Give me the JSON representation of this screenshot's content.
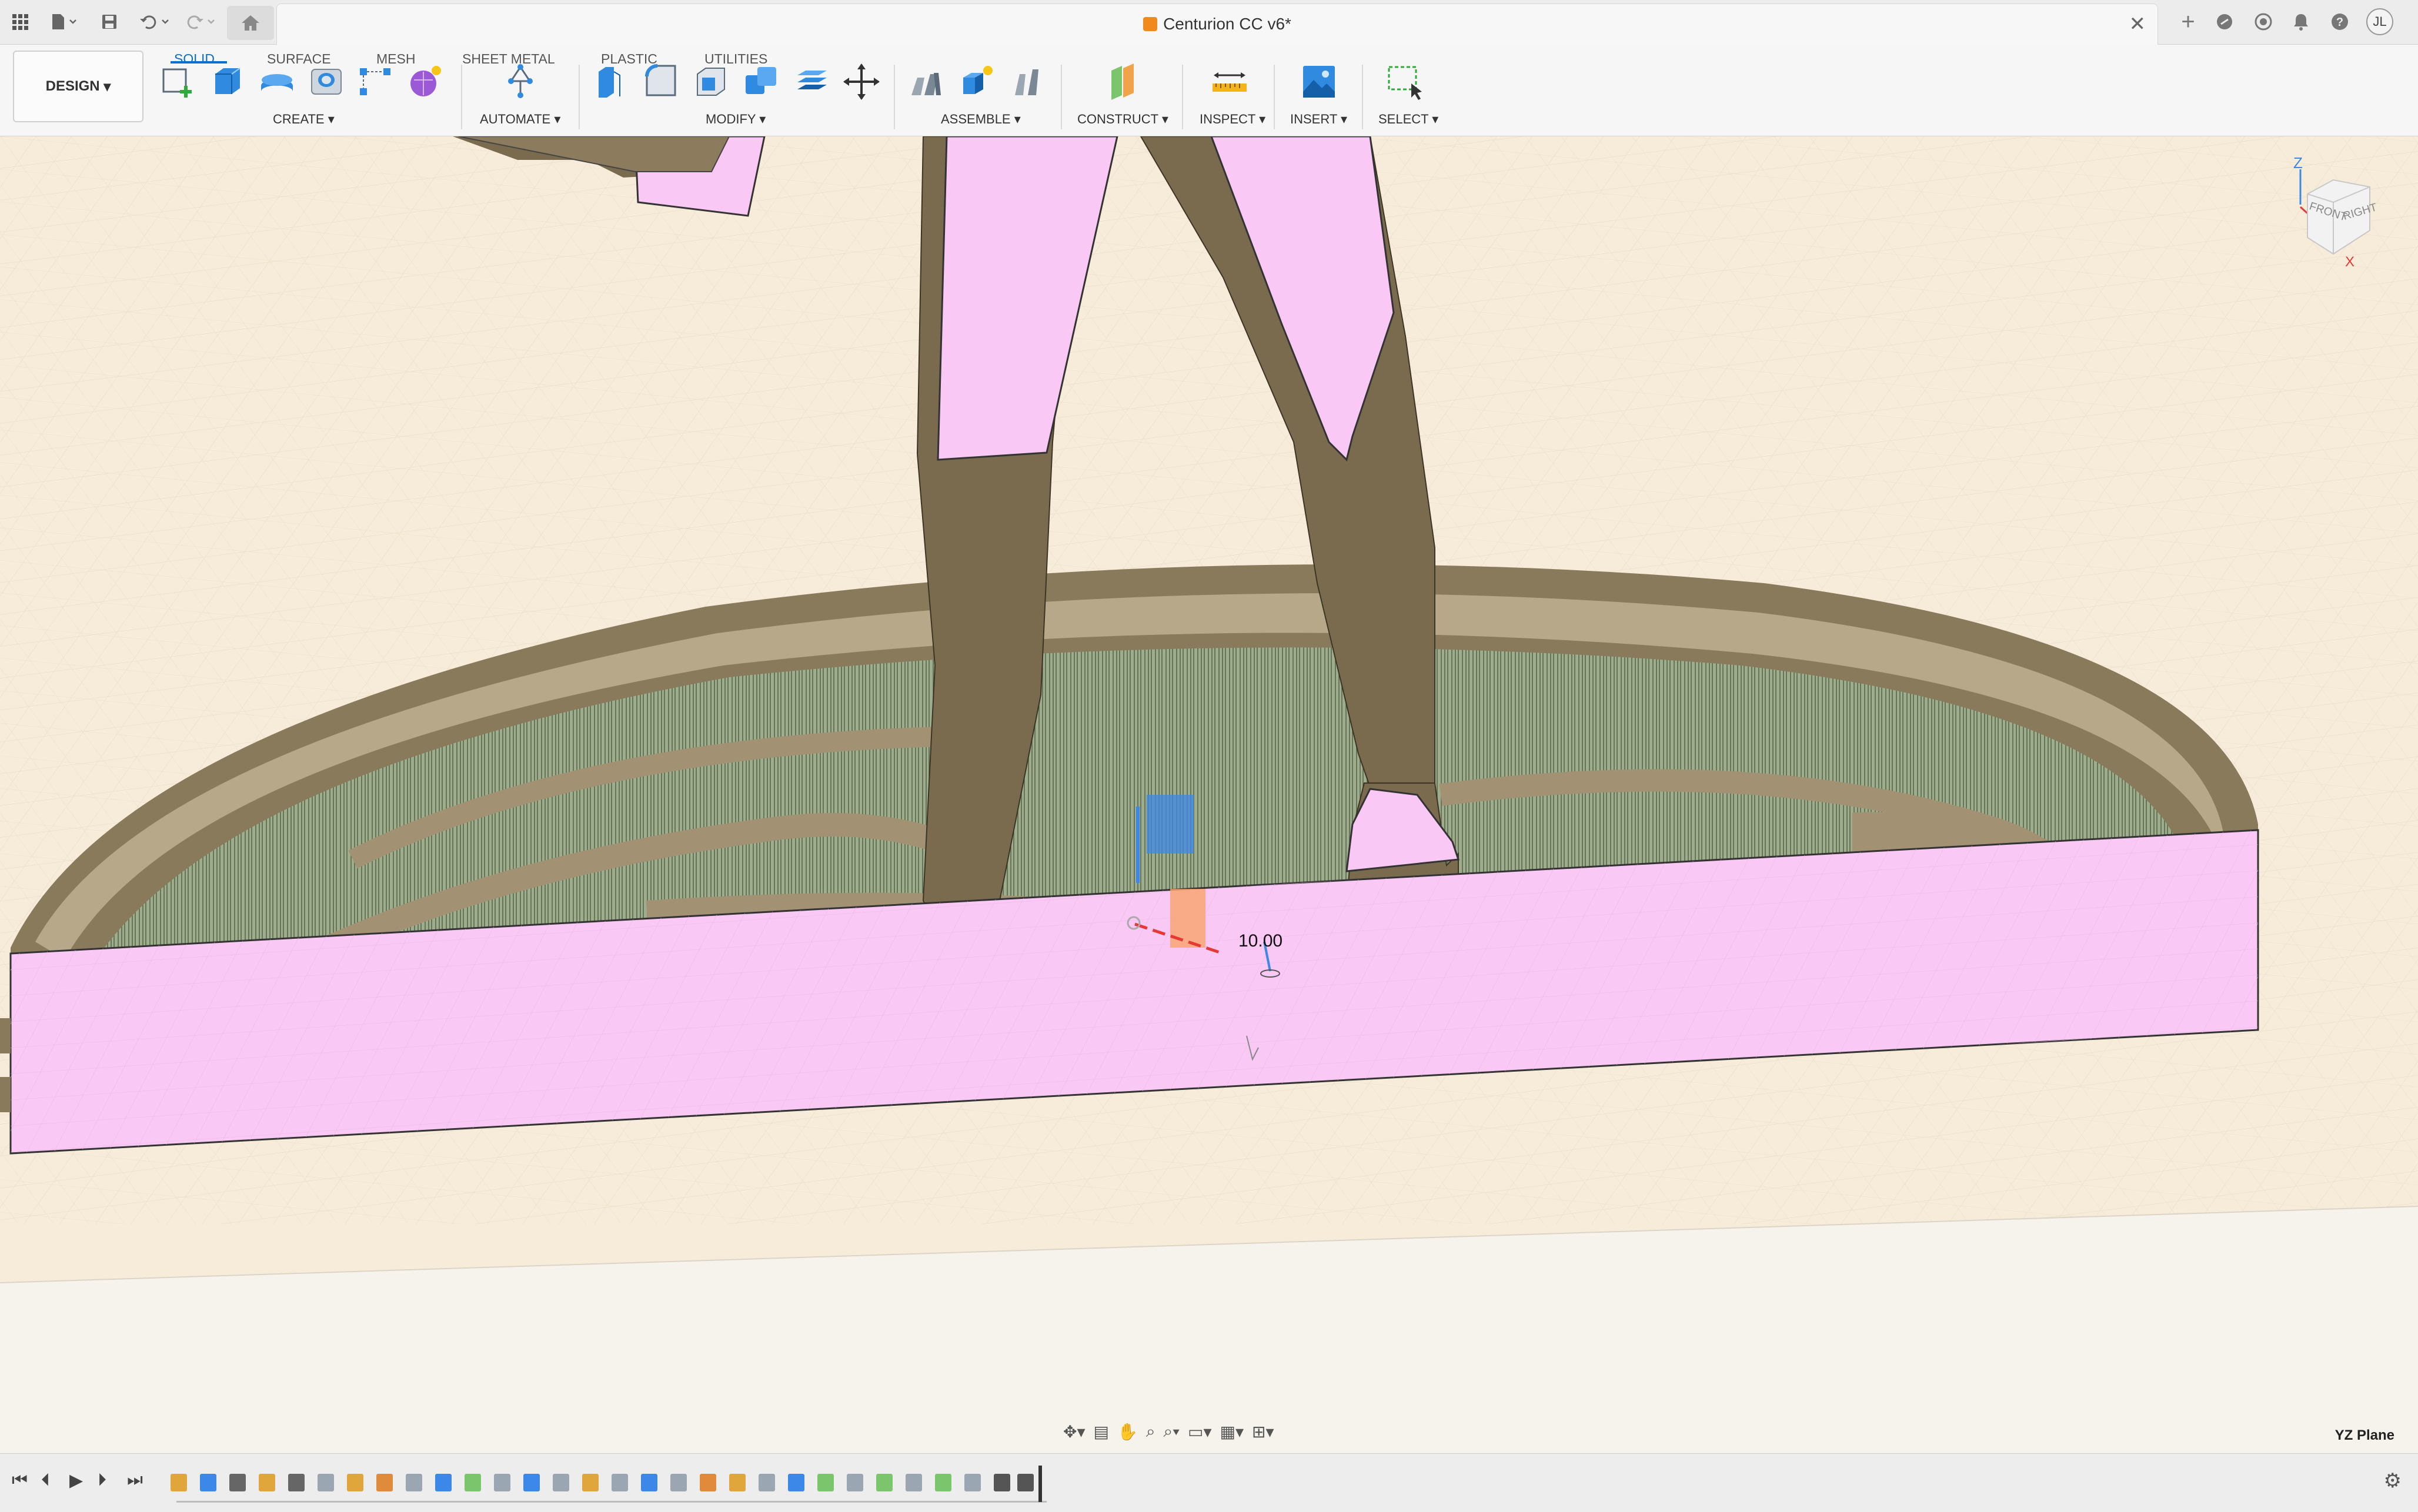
{
  "app": {
    "document_title": "Centurion CC v6*",
    "user_initials": "JL"
  },
  "toolbar": {
    "workspace_button": "DESIGN",
    "tabs": [
      "SOLID",
      "SURFACE",
      "MESH",
      "SHEET METAL",
      "PLASTIC",
      "UTILITIES"
    ],
    "active_tab": "SOLID",
    "groups": {
      "create": "CREATE",
      "automate": "AUTOMATE",
      "modify": "MODIFY",
      "assemble": "ASSEMBLE",
      "construct": "CONSTRUCT",
      "inspect": "INSPECT",
      "insert": "INSERT",
      "select": "SELECT"
    }
  },
  "viewcube": {
    "axis_z": "Z",
    "axis_x": "X",
    "face_front": "FRONT",
    "face_right": "RIGHT"
  },
  "viewport": {
    "dimension_value": "10.00",
    "selected_plane": "YZ Plane"
  },
  "colors": {
    "accent": "#0d6fcc",
    "section_pink": "#f9c8f4",
    "model_brown": "#8a7a5c",
    "grass_green": "#8fa585"
  }
}
